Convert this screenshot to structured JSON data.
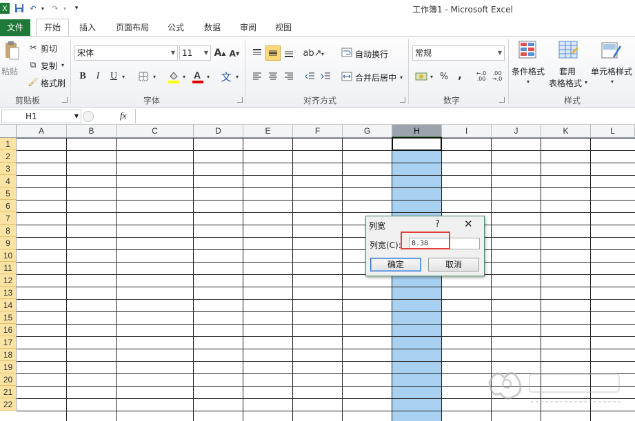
{
  "window": {
    "title": "工作簿1 - Microsoft Excel"
  },
  "tabs": [
    {
      "label": "文件"
    },
    {
      "label": "开始"
    },
    {
      "label": "插入"
    },
    {
      "label": "页面布局"
    },
    {
      "label": "公式"
    },
    {
      "label": "数据"
    },
    {
      "label": "审阅"
    },
    {
      "label": "视图"
    }
  ],
  "ribbon": {
    "clipboard": {
      "paste": "粘贴",
      "cut": "剪切",
      "copy": "复制",
      "format_painter": "格式刷",
      "group": "剪贴板"
    },
    "font": {
      "font_name": "宋体",
      "font_size": "11",
      "bold": "B",
      "italic": "I",
      "underline": "U",
      "group": "字体"
    },
    "alignment": {
      "wrap_text": "自动换行",
      "merge_center": "合并后居中",
      "group": "对齐方式"
    },
    "number": {
      "format": "常规",
      "percent": "%",
      "comma": ",",
      "group": "数字"
    },
    "styles": {
      "conditional": "条件格式",
      "table_format_1": "套用",
      "table_format_2": "表格格式",
      "cell_styles": "单元格样式",
      "group": "样式"
    }
  },
  "formula_bar": {
    "name_box": "H1",
    "fx": "fx"
  },
  "columns": [
    "A",
    "B",
    "C",
    "D",
    "E",
    "F",
    "G",
    "H",
    "I",
    "J",
    "K",
    "L"
  ],
  "rows": [
    "1",
    "2",
    "3",
    "4",
    "5",
    "6",
    "7",
    "8",
    "9",
    "10",
    "11",
    "12",
    "13",
    "14",
    "15",
    "16",
    "17",
    "18",
    "19",
    "20",
    "21",
    "22"
  ],
  "dialog": {
    "title": "列宽",
    "help": "?",
    "field_label": "列宽(C):",
    "field_value": "8.38",
    "ok": "确定",
    "cancel": "取消"
  },
  "colors": {
    "file_tab": "#1f7a3a",
    "selected_column": "#a8d0f0",
    "highlight_box": "#e2403c"
  }
}
